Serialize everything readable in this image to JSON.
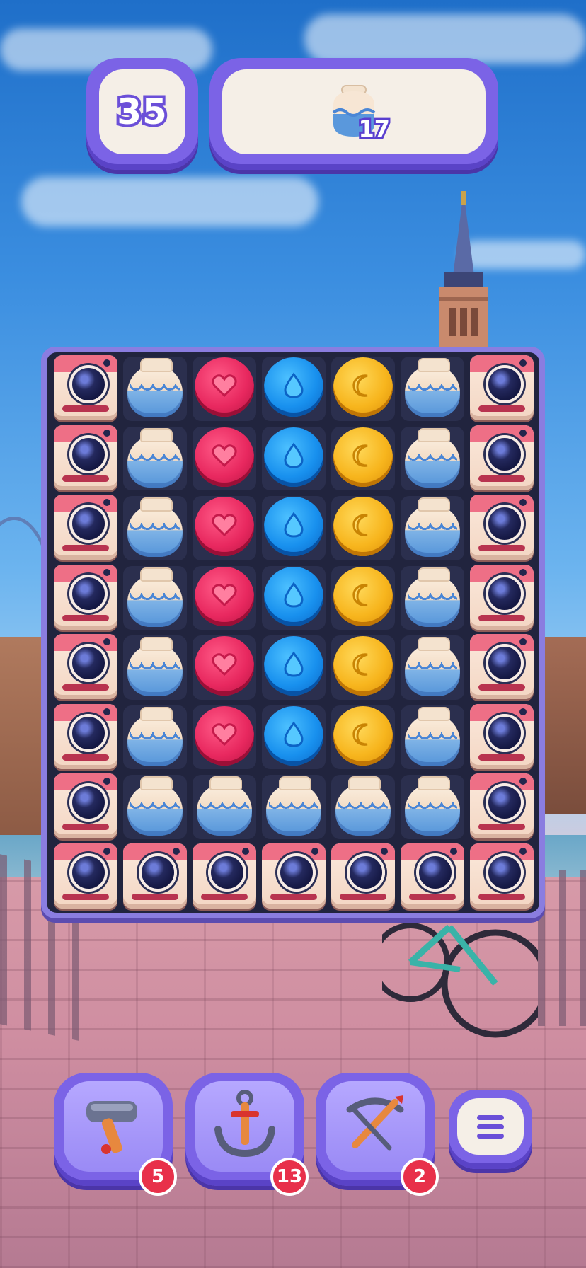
{
  "hud": {
    "moves_left": "35",
    "goal": {
      "icon": "vase-icon",
      "remaining": "17"
    }
  },
  "board": {
    "rows": 8,
    "cols": 7,
    "tiles": [
      [
        "camera",
        "vase",
        "heart",
        "drop",
        "moon",
        "vase",
        "camera"
      ],
      [
        "camera",
        "vase",
        "heart",
        "drop",
        "moon",
        "vase",
        "camera"
      ],
      [
        "camera",
        "vase",
        "heart",
        "drop",
        "moon",
        "vase",
        "camera"
      ],
      [
        "camera",
        "vase",
        "heart",
        "drop",
        "moon",
        "vase",
        "camera"
      ],
      [
        "camera",
        "vase",
        "heart",
        "drop",
        "moon",
        "vase",
        "camera"
      ],
      [
        "camera",
        "vase",
        "heart",
        "drop",
        "moon",
        "vase",
        "camera"
      ],
      [
        "camera",
        "vase",
        "vase",
        "vase",
        "vase",
        "vase",
        "camera"
      ],
      [
        "camera",
        "camera",
        "camera",
        "camera",
        "camera",
        "camera",
        "camera"
      ]
    ]
  },
  "boosters": [
    {
      "name": "hammer",
      "icon": "hammer-icon",
      "count": "5"
    },
    {
      "name": "anchor",
      "icon": "anchor-icon",
      "count": "13"
    },
    {
      "name": "crossbow",
      "icon": "crossbow-icon",
      "count": "2"
    }
  ],
  "menu": {
    "icon": "menu-icon"
  },
  "colors": {
    "frame": "#7b63e6",
    "panel": "#f5efe7",
    "badge": "#e8304a",
    "heart": "#e8285f",
    "drop": "#1890ee",
    "moon": "#f7b51d"
  }
}
